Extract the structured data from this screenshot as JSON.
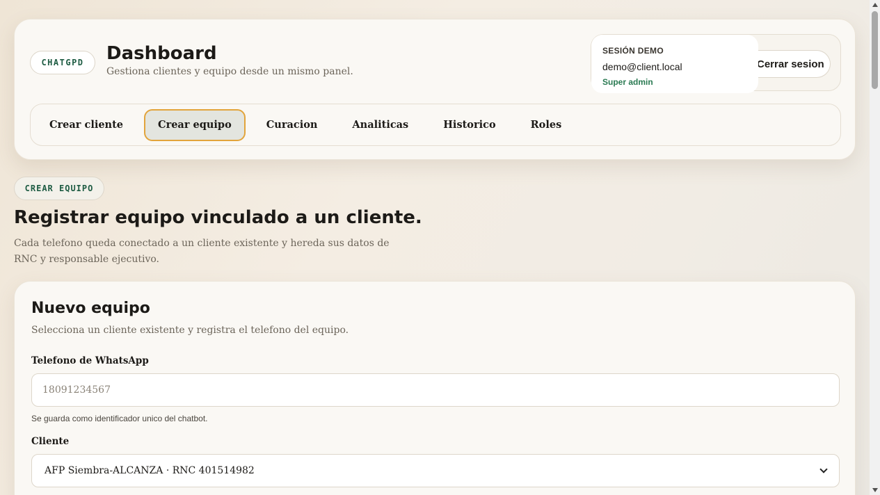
{
  "header": {
    "brand": "CHATGPD",
    "title": "Dashboard",
    "subtitle": "Gestiona clientes y equipo desde un mismo panel.",
    "session": {
      "label": "SESIÓN DEMO",
      "email": "demo@client.local",
      "role": "Super admin",
      "logout_label": "Cerrar sesion"
    },
    "tabs": [
      {
        "label": "Crear cliente",
        "active": false
      },
      {
        "label": "Crear equipo",
        "active": true
      },
      {
        "label": "Curacion",
        "active": false
      },
      {
        "label": "Analiticas",
        "active": false
      },
      {
        "label": "Historico",
        "active": false
      },
      {
        "label": "Roles",
        "active": false
      }
    ]
  },
  "section": {
    "pill": "CREAR EQUIPO",
    "title": "Registrar equipo vinculado a un cliente.",
    "description": "Cada telefono queda conectado a un cliente existente y hereda sus datos de RNC y responsable ejecutivo."
  },
  "form": {
    "title": "Nuevo equipo",
    "subtitle": "Selecciona un cliente existente y registra el telefono del equipo.",
    "phone": {
      "label": "Telefono de WhatsApp",
      "placeholder": "18091234567",
      "value": "",
      "hint": "Se guarda como identificador unico del chatbot."
    },
    "client": {
      "label": "Cliente",
      "selected": "AFP Siembra-ALCANZA · RNC 401514982"
    }
  },
  "colors": {
    "accent_green": "#1e5c43",
    "role_green": "#2a7a52",
    "active_tab_border": "#e2a43b"
  }
}
